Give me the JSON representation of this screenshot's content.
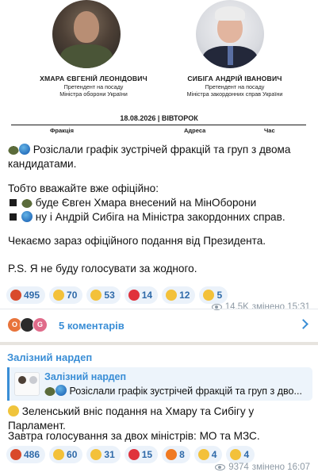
{
  "post": {
    "image": {
      "candidate_1": {
        "name": "ХМАРА ЄВГЕНІЙ ЛЕОНІДОВИЧ",
        "role_line1": "Претендент на посаду",
        "role_line2": "Міністра оборони України"
      },
      "candidate_2": {
        "name": "СИБІГА АНДРІЙ ІВАНОВИЧ",
        "role_line1": "Претендент на посаду",
        "role_line2": "Міністра закордонних справ України"
      },
      "date": "18.08.2026  |  ВІВТОРОК",
      "columns": [
        "Фракція",
        "Адреса",
        "Час"
      ]
    },
    "text": {
      "line1": "Розіслали графік зустрічей фракцій та груп з двома кандидатами.",
      "line2": "Тобто вважайте вже офіційно:",
      "bullet1": "буде Євген Хмара внесений на МінОборони",
      "bullet2": "ну і Андрій Сибіга на Міністра закордонних справ.",
      "line3": "Чекаємо зараз офіційного подання від Президента.",
      "line4": "P.S. Я не буду голосувати за жодного."
    },
    "reactions": [
      {
        "emoji": "angry-face-icon",
        "count": "495",
        "color": "#d94a2b"
      },
      {
        "emoji": "rofl-face-icon",
        "count": "70",
        "color": "#f3c13a"
      },
      {
        "emoji": "thumbs-up-icon",
        "count": "53",
        "color": "#f3c13a"
      },
      {
        "emoji": "red-heart-icon",
        "count": "14",
        "color": "#e0323c"
      },
      {
        "emoji": "crying-face-icon",
        "count": "12",
        "color": "#f3c13a"
      },
      {
        "emoji": "exploding-head-icon",
        "count": "5",
        "color": "#f3c13a"
      }
    ],
    "views": "14.5K",
    "edited": "змінено 15:31",
    "comments": {
      "label": "5 коментарів",
      "avatars": [
        "O",
        "",
        "G"
      ]
    }
  },
  "post2": {
    "author": "Залізний нардеп",
    "quote": {
      "author": "Залізний нардеп",
      "text": "Розіслали графік зустрічей фракцій та груп з дво..."
    },
    "text": {
      "line1": "Зеленський вніс подання на Хмару та Сибігу у Парламент.",
      "line2": "Завтра голосування за двох міністрів: МО та МЗС."
    },
    "reactions": [
      {
        "emoji": "angry-face-icon",
        "count": "486",
        "color": "#d94a2b"
      },
      {
        "emoji": "exploding-head-icon",
        "count": "60",
        "color": "#f3c13a"
      },
      {
        "emoji": "rofl-face-icon",
        "count": "31",
        "color": "#f3c13a"
      },
      {
        "emoji": "red-heart-icon",
        "count": "15",
        "color": "#e0323c"
      },
      {
        "emoji": "fire-icon",
        "count": "8",
        "color": "#f07a22"
      },
      {
        "emoji": "thumbs-up-icon",
        "count": "4",
        "color": "#f3c13a"
      },
      {
        "emoji": "scream-face-icon",
        "count": "4",
        "color": "#f3c13a"
      }
    ],
    "views": "9374",
    "edited": "змінено 16:07"
  },
  "colors": {
    "accent": "#3a8ed6",
    "reaction_bg": "#ebf2fa",
    "chat_bg": "#e7e4df"
  }
}
